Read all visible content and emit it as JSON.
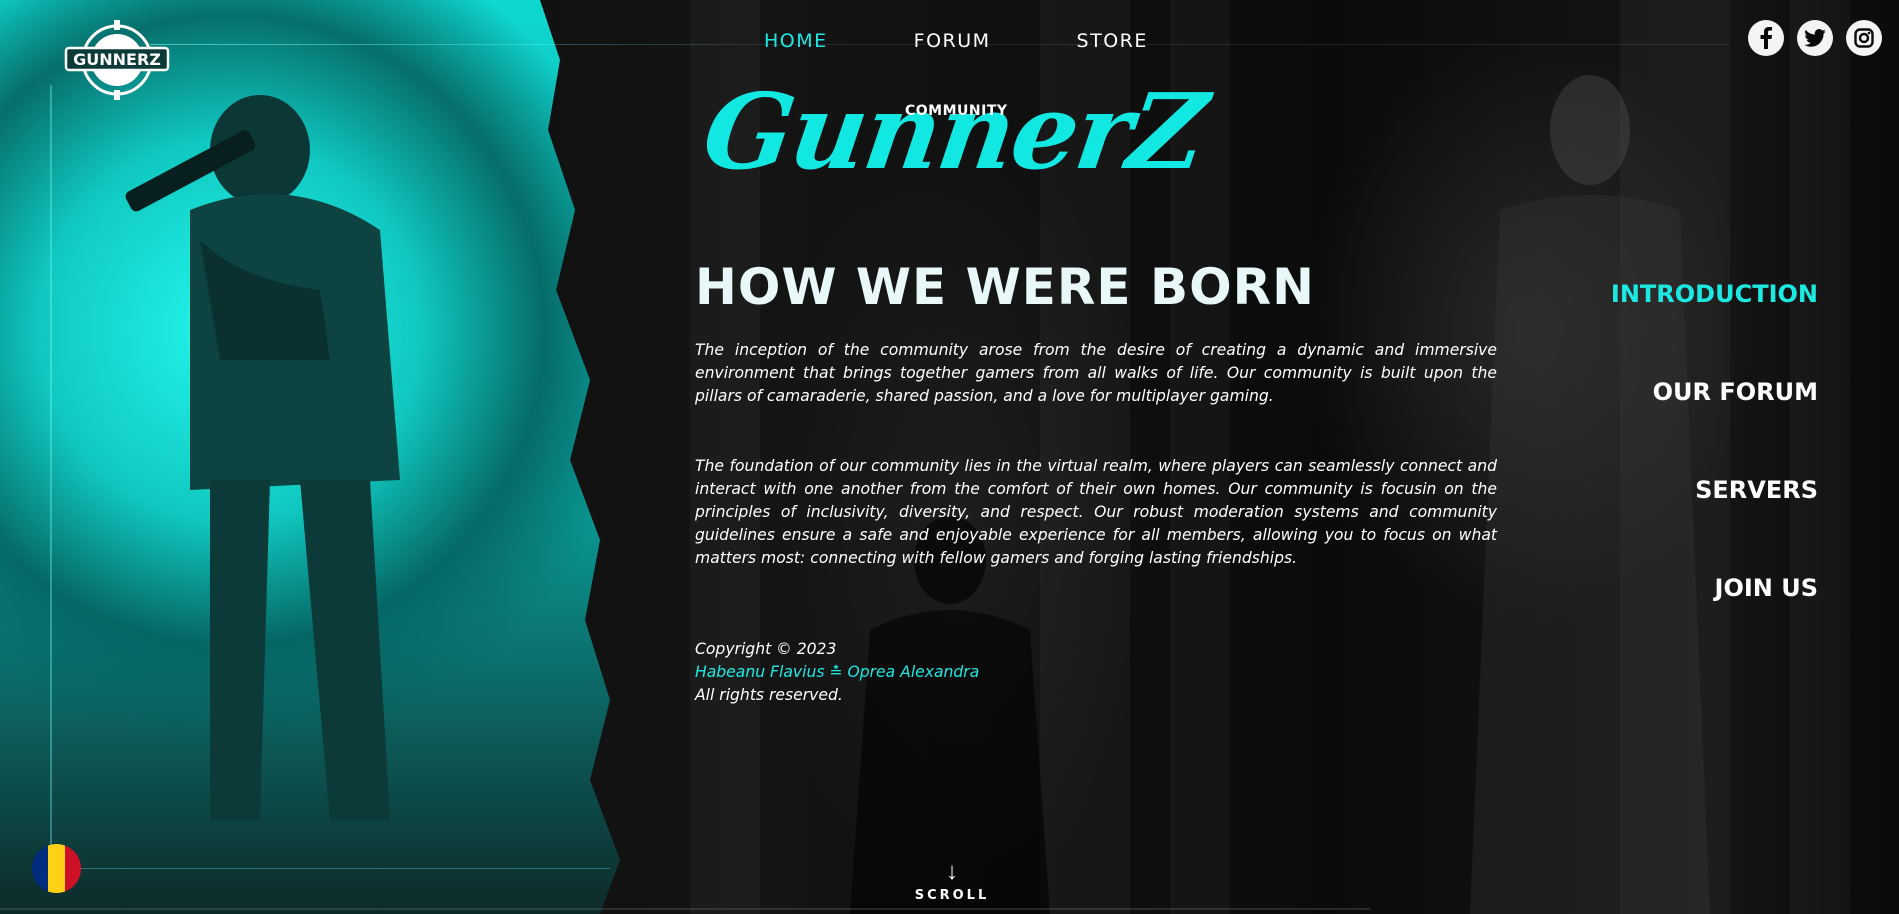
{
  "logo": {
    "text": "GUNNERZ"
  },
  "topnav": {
    "items": [
      {
        "label": "HOME",
        "active": true
      },
      {
        "label": "FORUM",
        "active": false
      },
      {
        "label": "STORE",
        "active": false
      }
    ]
  },
  "social": {
    "icons": [
      "facebook-icon",
      "twitter-icon",
      "instagram-icon"
    ]
  },
  "hero": {
    "community_label": "COMMUNITY",
    "brand_title": "GunnerZ"
  },
  "main": {
    "heading": "HOW WE WERE BORN",
    "paragraph1": "The inception of the community arose from the desire of creating a dynamic and immersive environment that brings together gamers from all walks of life. Our community is built upon the pillars of camaraderie, shared passion, and a love for multiplayer gaming.",
    "paragraph2": "The foundation of our community lies in the virtual realm, where players can seamlessly connect and interact with one another from the comfort of their own homes. Our community is focusin on the principles of inclusivity, diversity, and respect. Our robust moderation systems and community guidelines ensure a safe and enjoyable experience for all members, allowing you to focus on what matters most: connecting with fellow gamers and forging lasting friendships."
  },
  "footer": {
    "copyright": "Copyright © 2023",
    "authors": "Habeanu Flavius ≛ Oprea Alexandra",
    "rights": "All rights reserved."
  },
  "sidenav": {
    "items": [
      {
        "label": "INTRODUCTION",
        "active": true
      },
      {
        "label": "OUR FORUM",
        "active": false
      },
      {
        "label": "SERVERS",
        "active": false
      },
      {
        "label": "JOIN US",
        "active": false
      }
    ]
  },
  "scroll": {
    "arrow": "↓",
    "label": "SCROLL"
  },
  "language": {
    "flag": "romania-flag-icon",
    "colors": [
      "#002b7f",
      "#fcd116",
      "#ce1126"
    ]
  },
  "colors": {
    "accent": "#1de9e3",
    "background": "#0a0a0a",
    "text": "#ffffff"
  }
}
